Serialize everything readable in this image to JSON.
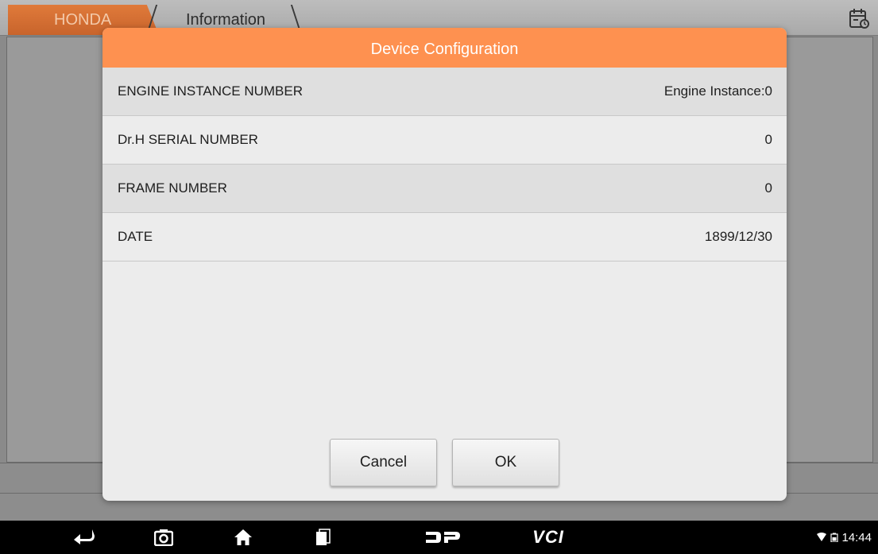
{
  "header": {
    "tabs": [
      {
        "label": "HONDA"
      },
      {
        "label": "Information"
      }
    ],
    "report_icon": "calendar-clock-icon"
  },
  "dialog": {
    "title": "Device Configuration",
    "rows": [
      {
        "label": "ENGINE INSTANCE NUMBER",
        "value": "Engine Instance:0"
      },
      {
        "label": "Dr.H SERIAL NUMBER",
        "value": "0"
      },
      {
        "label": "FRAME NUMBER",
        "value": "0"
      },
      {
        "label": "DATE",
        "value": "1899/12/30"
      }
    ],
    "cancel_label": "Cancel",
    "ok_label": "OK"
  },
  "navbar": {
    "icons": [
      "back-icon",
      "camera-icon",
      "home-icon",
      "recent-apps-icon",
      "dp-logo-icon"
    ],
    "vci_label": "VCI",
    "time": "14:44"
  },
  "colors": {
    "accent": "#fe9150",
    "tab_active": "#d06a30"
  }
}
